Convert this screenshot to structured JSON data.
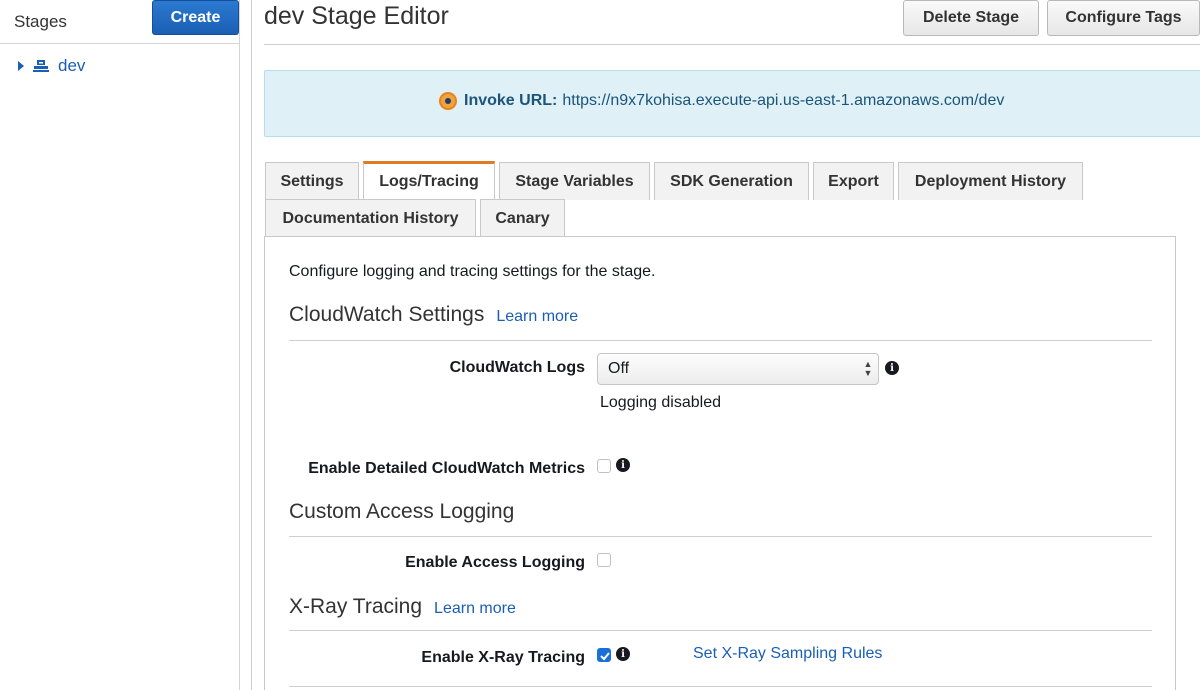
{
  "sidebar": {
    "title": "Stages",
    "create_label": "Create",
    "tree": [
      {
        "label": "dev"
      }
    ]
  },
  "header": {
    "title": "dev Stage Editor",
    "delete_label": "Delete Stage",
    "tags_label": "Configure Tags"
  },
  "invoke": {
    "label": "Invoke URL:",
    "url": "https://n9x7kohisa.execute-api.us-east-1.amazonaws.com/dev"
  },
  "tabs": [
    {
      "label": "Settings"
    },
    {
      "label": "Logs/Tracing",
      "active": true
    },
    {
      "label": "Stage Variables"
    },
    {
      "label": "SDK Generation"
    },
    {
      "label": "Export"
    },
    {
      "label": "Deployment History"
    },
    {
      "label": "Documentation History"
    },
    {
      "label": "Canary"
    }
  ],
  "content": {
    "intro": "Configure logging and tracing settings for the stage.",
    "cloudwatch": {
      "title": "CloudWatch Settings",
      "learn_more": "Learn more",
      "logs_label": "CloudWatch Logs",
      "logs_value": "Off",
      "logs_hint": "Logging disabled",
      "metrics_label": "Enable Detailed CloudWatch Metrics",
      "metrics_checked": false
    },
    "access_logging": {
      "title": "Custom Access Logging",
      "enable_label": "Enable Access Logging",
      "enable_checked": false
    },
    "xray": {
      "title": "X-Ray Tracing",
      "learn_more": "Learn more",
      "enable_label": "Enable X-Ray Tracing",
      "enable_checked": true,
      "sampling_link": "Set X-Ray Sampling Rules"
    }
  },
  "colors": {
    "primary_button": "#1a5fb4",
    "active_tab_accent": "#e07b25",
    "banner_bg": "#dff0f7",
    "link": "#1a5fb4"
  }
}
